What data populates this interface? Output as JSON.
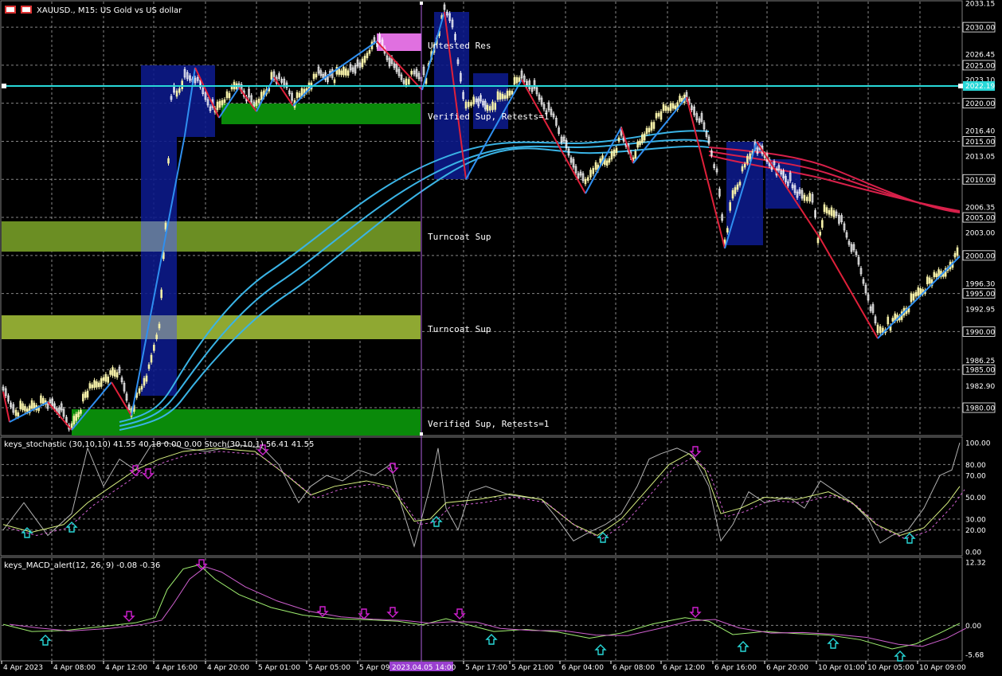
{
  "title": "XAUUSD., M15: US Gold vs US dollar",
  "colors": {
    "background": "#000000",
    "grid": "#c0c0c0",
    "bull_candle": "#f5f0a8",
    "bear_candle": "#ffffff",
    "zigzag_up": "#2f8ff0",
    "zigzag_down": "#e0203a",
    "ma_blue": "#3ab4e6",
    "ma_red": "#d8204a",
    "current_price_line": "#28d8d8",
    "stoch_main": "#b0b0b0",
    "stoch_signal": "#d8f080",
    "stoch_dashed": "#d060d0",
    "macd_main": "#a0f070",
    "macd_signal": "#d060d0",
    "arrow_up": "#28d8d8",
    "arrow_down": "#d020d0"
  },
  "price_axis": {
    "current_price": "2022.19",
    "labels": [
      {
        "text": "2033.15",
        "value": 2033.15,
        "boxed": false
      },
      {
        "text": "2030.00",
        "value": 2030.0,
        "boxed": true
      },
      {
        "text": "2026.45",
        "value": 2026.45,
        "boxed": false
      },
      {
        "text": "2025.00",
        "value": 2025.0,
        "boxed": true
      },
      {
        "text": "2023.10",
        "value": 2023.1,
        "boxed": false
      },
      {
        "text": "2020.00",
        "value": 2020.0,
        "boxed": true
      },
      {
        "text": "2016.40",
        "value": 2016.4,
        "boxed": false
      },
      {
        "text": "2015.00",
        "value": 2015.0,
        "boxed": true
      },
      {
        "text": "2013.05",
        "value": 2013.05,
        "boxed": false
      },
      {
        "text": "2010.00",
        "value": 2010.0,
        "boxed": true
      },
      {
        "text": "2006.35",
        "value": 2006.35,
        "boxed": false
      },
      {
        "text": "2005.00",
        "value": 2005.0,
        "boxed": true
      },
      {
        "text": "2003.00",
        "value": 2003.0,
        "boxed": false
      },
      {
        "text": "2000.00",
        "value": 2000.0,
        "boxed": true
      },
      {
        "text": "1996.30",
        "value": 1996.3,
        "boxed": false
      },
      {
        "text": "1995.00",
        "value": 1995.0,
        "boxed": true
      },
      {
        "text": "1992.95",
        "value": 1992.95,
        "boxed": false
      },
      {
        "text": "1990.00",
        "value": 1990.0,
        "boxed": true
      },
      {
        "text": "1986.25",
        "value": 1986.25,
        "boxed": false
      },
      {
        "text": "1985.00",
        "value": 1985.0,
        "boxed": true
      },
      {
        "text": "1982.90",
        "value": 1982.9,
        "boxed": false
      },
      {
        "text": "1980.00",
        "value": 1980.0,
        "boxed": true
      }
    ]
  },
  "zones": [
    {
      "label": "Untested Res"
    },
    {
      "label": "Verified Sup, Retests=1"
    },
    {
      "label": "Turncoat Sup"
    },
    {
      "label": "Turncoat Sup"
    },
    {
      "label": "Verified Sup, Retests=1"
    }
  ],
  "stochastic": {
    "header": "keys_stochastic (30,10,10) 41.55 40.18 0.00 0.00 Stoch(30,10,1) 56.41 41.55",
    "levels": [
      {
        "text": "100.00",
        "value": 100
      },
      {
        "text": "80.00",
        "value": 80
      },
      {
        "text": "70.00",
        "value": 70
      },
      {
        "text": "50.00",
        "value": 50
      },
      {
        "text": "30.00",
        "value": 30
      },
      {
        "text": "20.00",
        "value": 20
      },
      {
        "text": "0.00",
        "value": 0
      }
    ]
  },
  "macd": {
    "header": "keys_MACD_alert(12, 26, 9) -0.08 -0.36",
    "levels": [
      {
        "text": "12.32",
        "value": 12.32
      },
      {
        "text": "0.00",
        "value": 0
      },
      {
        "text": "-5.68",
        "value": -5.68
      }
    ]
  },
  "time_axis": {
    "labels": [
      "4 Apr 2023",
      "4 Apr 08:00",
      "4 Apr 12:00",
      "4 Apr 16:00",
      "4 Apr 20:00",
      "5 Apr 01:00",
      "5 Apr 05:00",
      "5 Apr 09:00",
      "5 Apr 17:00",
      "5 Apr 21:00",
      "6 Apr 04:00",
      "6 Apr 08:00",
      "6 Apr 12:00",
      "6 Apr 16:00",
      "6 Apr 20:00",
      "10 Apr 01:00",
      "10 Apr 05:00",
      "10 Apr 09:00"
    ],
    "cursor_label": "2023.04.05 14:00"
  }
}
